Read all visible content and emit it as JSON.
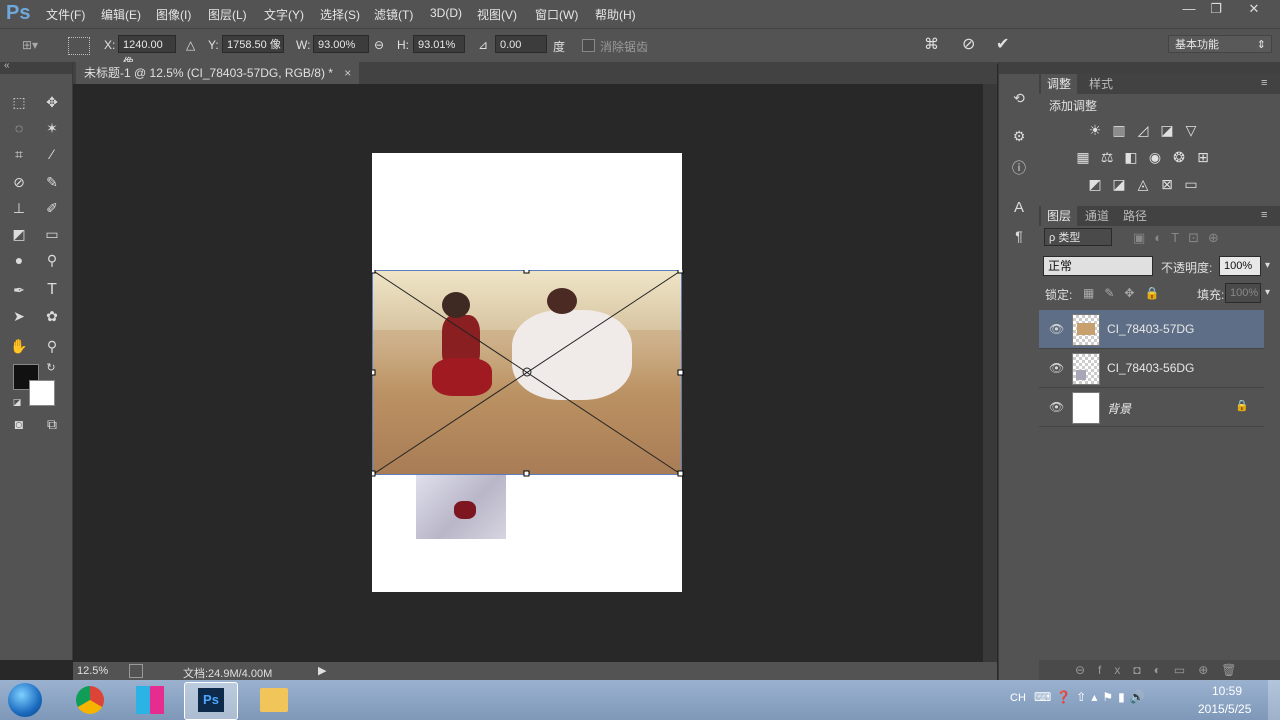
{
  "app": {
    "logo": "Ps"
  },
  "menu": [
    "文件(F)",
    "编辑(E)",
    "图像(I)",
    "图层(L)",
    "文字(Y)",
    "选择(S)",
    "滤镜(T)",
    "3D(D)",
    "视图(V)",
    "窗口(W)",
    "帮助(H)"
  ],
  "window_controls": {
    "minimize": "—",
    "restore": "❐",
    "close": "✕"
  },
  "options": {
    "x_label": "X:",
    "x_value": "1240.00 像",
    "y_label": "Y:",
    "y_value": "1758.50 像",
    "w_label": "W:",
    "w_value": "93.00%",
    "h_label": "H:",
    "h_value": "93.01%",
    "angle_value": "0.00",
    "angle_unit": "度",
    "antialias_label": "消除锯齿",
    "workspace": "基本功能"
  },
  "document": {
    "tab_title": "未标题-1 @ 12.5% (CI_78403-57DG, RGB/8) *",
    "close": "×"
  },
  "status": {
    "zoom": "12.5%",
    "doc_info": "文档:24.9M/4.00M"
  },
  "adjust_panel": {
    "tab_adjust": "调整",
    "tab_styles": "样式",
    "title": "添加调整"
  },
  "layers_panel": {
    "tab_layers": "图层",
    "tab_channels": "通道",
    "tab_paths": "路径",
    "filter_kind": "ρ 类型",
    "blend_mode": "正常",
    "opacity_label": "不透明度:",
    "opacity_value": "100%",
    "lock_label": "锁定:",
    "fill_label": "填充:",
    "fill_value": "100%",
    "layers": [
      {
        "name": "CI_78403-57DG",
        "selected": true
      },
      {
        "name": "CI_78403-56DG",
        "selected": false
      },
      {
        "name": "背景",
        "selected": false,
        "locked": true
      }
    ]
  },
  "taskbar": {
    "lang": "CH",
    "time": "10:59",
    "date": "2015/5/25"
  },
  "colors": {
    "accent": "#5e6e86",
    "canvas_bg": "#282828",
    "panel": "#535353"
  }
}
